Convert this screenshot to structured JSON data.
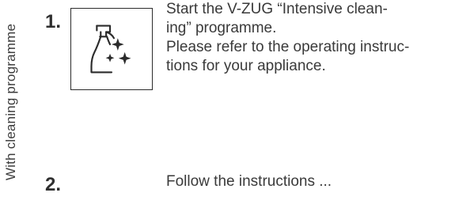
{
  "side_label": "With cleaning programme",
  "steps": [
    {
      "number": "1.",
      "icon": "spray-bottle-sparkle-icon",
      "lines": [
        "Start the V-ZUG “Intensive clean-",
        "ing” programme.",
        "Please refer to the operating instruc-",
        "tions for your appliance."
      ]
    },
    {
      "number": "2.",
      "text": "Follow the instructions ..."
    }
  ]
}
